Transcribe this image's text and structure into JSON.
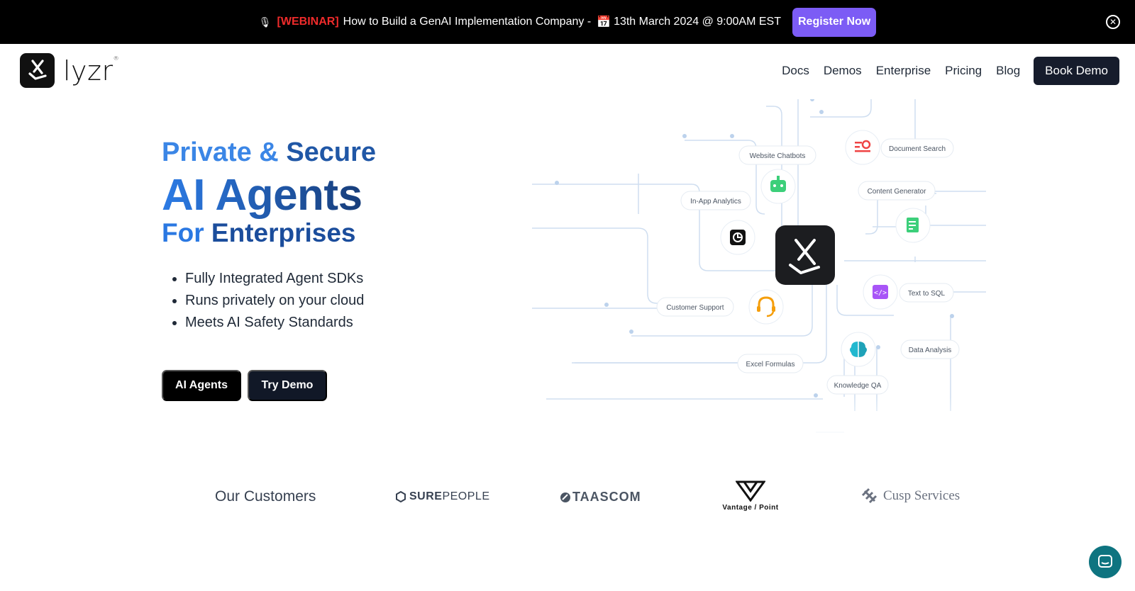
{
  "banner": {
    "mic_icon": "🎙",
    "tag": "[WEBINAR]",
    "text": "How to Build a GenAI Implementation Company -",
    "calendar_icon": "📅",
    "date": "13th March 2024 @ 9:00AM EST",
    "register_label": "Register Now",
    "register_color": "#7c5cf5"
  },
  "header": {
    "logo_text": "lyzr",
    "nav": [
      "Docs",
      "Demos",
      "Enterprise",
      "Pricing",
      "Blog"
    ],
    "book_demo": "Book Demo"
  },
  "hero": {
    "line1a": "Private &",
    "line1b": "Secure",
    "line2": "AI Agents",
    "line3a": "For",
    "line3b": "Enterprises",
    "bullets": [
      "Fully Integrated Agent SDKs",
      "Runs privately on your cloud",
      "Meets AI Safety Standards"
    ],
    "btn_agents": "AI Agents",
    "btn_try": "Try Demo"
  },
  "diagram": {
    "labels": {
      "website_chatbots": "Website Chatbots",
      "document_search": "Document Search",
      "in_app_analytics": "In-App Analytics",
      "content_generator": "Content Generator",
      "customer_support": "Customer Support",
      "text_to_sql": "Text to SQL",
      "data_analysis": "Data Analysis",
      "excel_formulas": "Excel Formulas",
      "knowledge_qa": "Knowledge QA"
    }
  },
  "customers": {
    "title": "Our Customers",
    "sure_bold": "SURE",
    "sure_light": "PEOPLE",
    "taascom": "TAASCOM",
    "vantage": "Vantage / Point",
    "cusp": "Cusp Services"
  }
}
